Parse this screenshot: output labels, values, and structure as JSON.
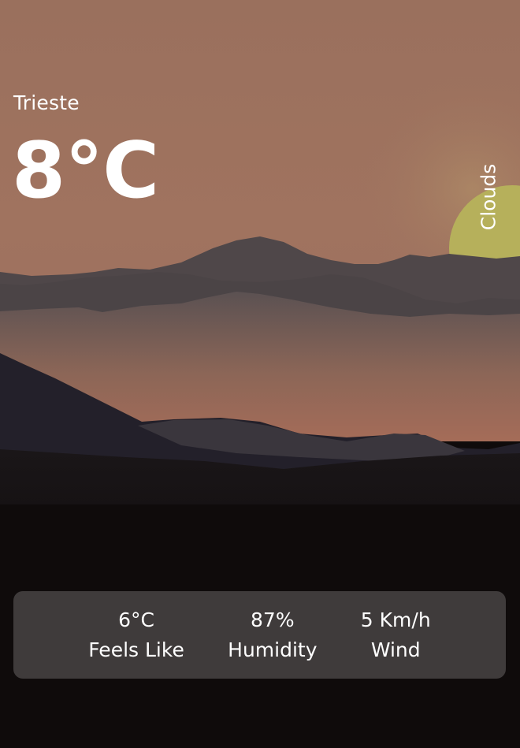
{
  "weather": {
    "city": "Trieste",
    "temperature": "8°C",
    "condition": "Clouds"
  },
  "stats": [
    {
      "value": "6°C",
      "label": "Feels Like"
    },
    {
      "value": "87%",
      "label": "Humidity"
    },
    {
      "value": "5 Km/h",
      "label": "Wind"
    }
  ],
  "colors": {
    "sky": "#9d7360",
    "sun": "#b9b35c",
    "ground": "#0f0b0b",
    "panel": "rgba(255,255,255,0.2)"
  }
}
